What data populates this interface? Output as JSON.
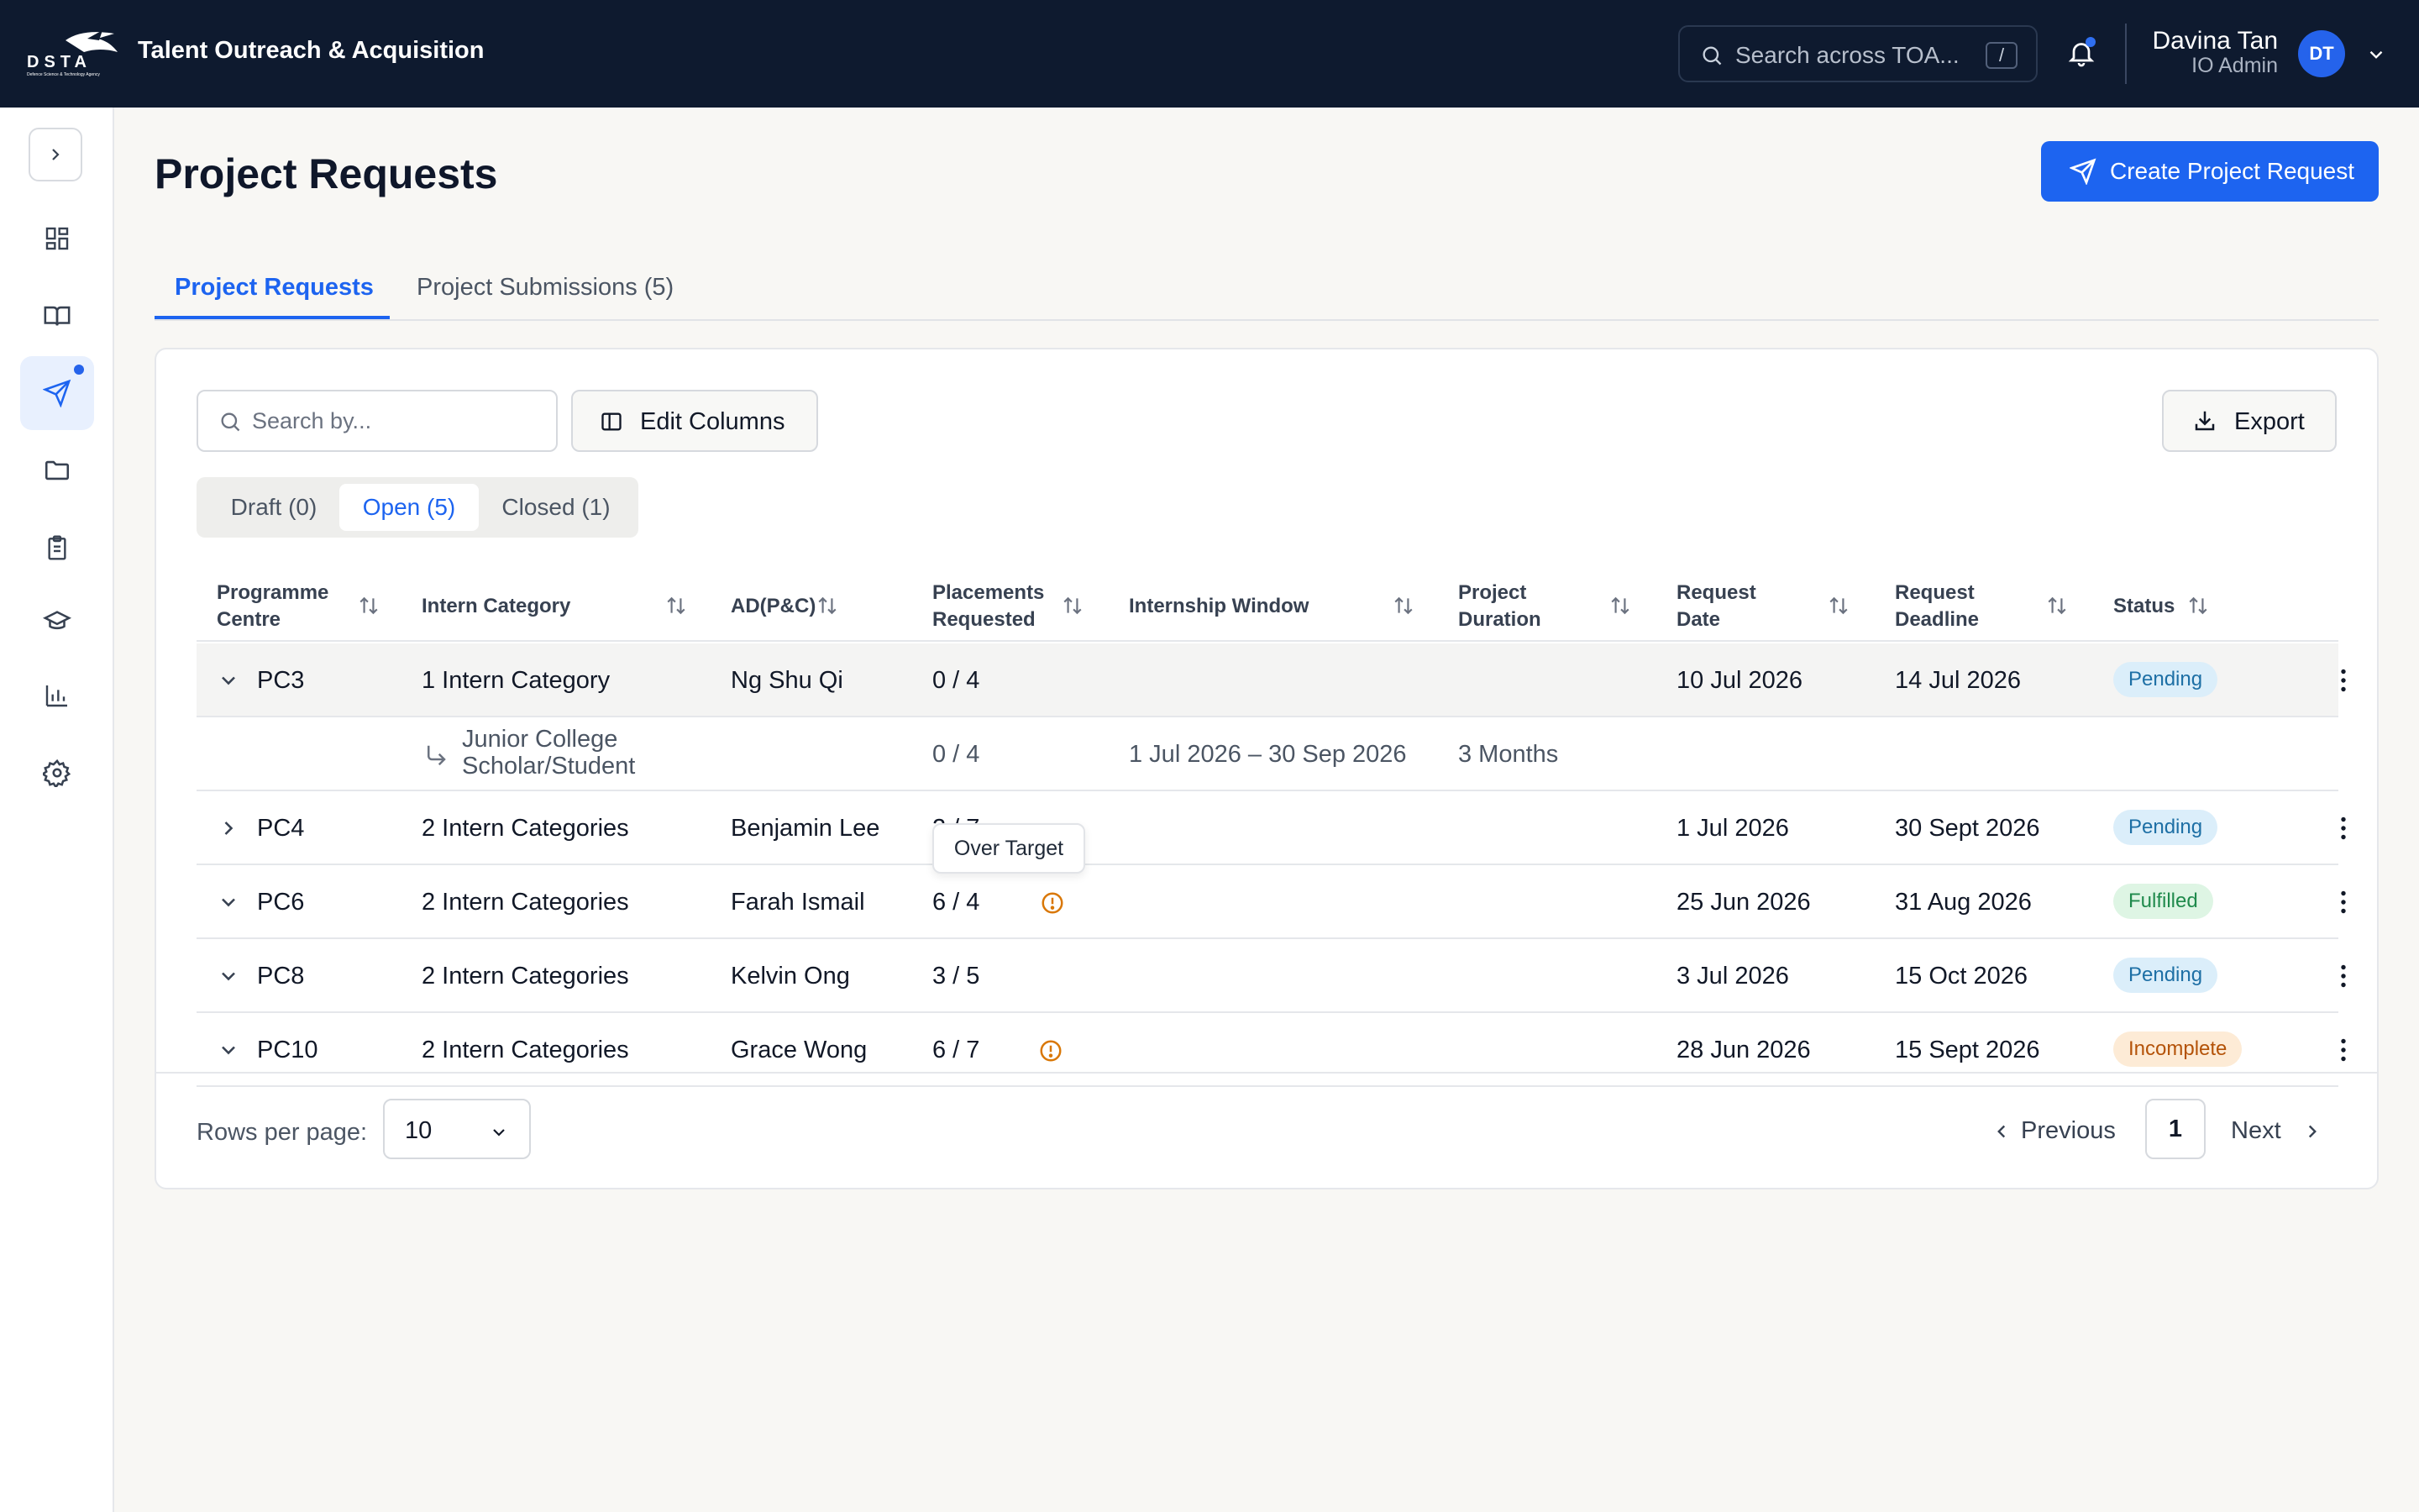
{
  "app": {
    "title": "Talent Outreach & Acquisition",
    "logo_text": "DSTA",
    "logo_subtext": "Defence Science & Technology Agency",
    "search_placeholder": "Search across TOA...",
    "search_shortcut": "/",
    "notifications_unread": true
  },
  "user": {
    "name": "Davina Tan",
    "role": "IO Admin",
    "initials": "DT"
  },
  "sidebar": {
    "items": [
      {
        "icon": "dashboard-icon",
        "active": false
      },
      {
        "icon": "book-icon",
        "active": false
      },
      {
        "icon": "send-icon",
        "active": true,
        "dot": true
      },
      {
        "icon": "folder-icon",
        "active": false
      },
      {
        "icon": "clipboard-icon",
        "active": false
      },
      {
        "icon": "graduation-cap-icon",
        "active": false
      },
      {
        "icon": "bar-chart-icon",
        "active": false
      },
      {
        "icon": "settings-icon",
        "active": false
      }
    ]
  },
  "page": {
    "title": "Project Requests",
    "create_button": "Create Project Request",
    "tabs": [
      {
        "label": "Project Requests",
        "active": true
      },
      {
        "label": "Project Submissions (5)",
        "active": false
      }
    ]
  },
  "toolbar": {
    "search_placeholder": "Search by...",
    "edit_columns": "Edit Columns",
    "export": "Export"
  },
  "filters": [
    {
      "label": "Draft (0)",
      "active": false
    },
    {
      "label": "Open (5)",
      "active": true
    },
    {
      "label": "Closed (1)",
      "active": false
    }
  ],
  "table": {
    "columns": [
      {
        "line1": "Programme",
        "line2": "Centre"
      },
      {
        "line1": "Intern Category",
        "line2": ""
      },
      {
        "line1": "AD(P&C)",
        "line2": ""
      },
      {
        "line1": "Placements",
        "line2": "Requested"
      },
      {
        "line1": "Internship Window",
        "line2": ""
      },
      {
        "line1": "Project",
        "line2": "Duration"
      },
      {
        "line1": "Request",
        "line2": "Date"
      },
      {
        "line1": "Request",
        "line2": "Deadline"
      },
      {
        "line1": "Status",
        "line2": ""
      }
    ],
    "rows": [
      {
        "centre": "PC3",
        "category": "1 Intern Category",
        "ad": "Ng Shu Qi",
        "placements": "0 / 4",
        "date": "10 Jul 2026",
        "deadline": "14 Jul 2026",
        "status": "Pending",
        "expanded": true,
        "warning": false
      },
      {
        "centre": "PC4",
        "category": "2 Intern Categories",
        "ad": "Benjamin Lee",
        "placements": "2 / 7",
        "date": "1 Jul 2026",
        "deadline": "30 Sept 2026",
        "status": "Pending",
        "expanded": false,
        "warning": false
      },
      {
        "centre": "PC6",
        "category": "2 Intern Categories",
        "ad": "Farah Ismail",
        "placements": "6 / 4",
        "date": "25 Jun 2026",
        "deadline": "31 Aug 2026",
        "status": "Fulfilled",
        "expanded": true,
        "warning": true
      },
      {
        "centre": "PC8",
        "category": "2 Intern Categories",
        "ad": "Kelvin Ong",
        "placements": "3 / 5",
        "date": "3 Jul 2026",
        "deadline": "15 Oct 2026",
        "status": "Pending",
        "expanded": true,
        "warning": false
      },
      {
        "centre": "PC10",
        "category": "2 Intern Categories",
        "ad": "Grace Wong",
        "placements": "6 / 7",
        "date": "28 Jun 2026",
        "deadline": "15 Sept 2026",
        "status": "Incomplete",
        "expanded": true,
        "warning": true
      }
    ],
    "subrow": {
      "category_line1": "Junior College",
      "category_line2": "Scholar/Student",
      "placements": "0 / 4",
      "window": "1 Jul 2026 – 30 Sep 2026",
      "duration": "3 Months"
    },
    "tooltip": "Over Target"
  },
  "pagination": {
    "rows_per_page_label": "Rows per page:",
    "rows_per_page": "10",
    "previous": "Previous",
    "page": "1",
    "next": "Next"
  },
  "colors": {
    "topbar": "#0e1a2f",
    "primary": "#1d64f0",
    "pending_bg": "#dbeefa",
    "fulfilled_bg": "#def5e4",
    "incomplete_bg": "#fdebd6",
    "warning": "#d97706"
  }
}
